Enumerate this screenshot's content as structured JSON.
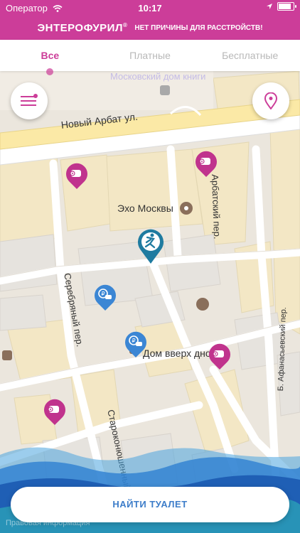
{
  "status_bar": {
    "carrier": "Оператор",
    "time": "10:17",
    "battery_level": 0.95
  },
  "banner": {
    "brand": "ЭНТЕРОФУРИЛ",
    "trademark": "®",
    "slogan": "НЕТ ПРИЧИНЫ ДЛЯ РАССТРОЙСТВ!"
  },
  "tabs": [
    {
      "label": "Все",
      "active": true
    },
    {
      "label": "Платные",
      "active": false
    },
    {
      "label": "Бесплатные",
      "active": false
    }
  ],
  "map": {
    "streets": {
      "noviy_arbat": "Новый Арбат ул.",
      "arbatskiy": "Арбатский пер.",
      "serebryaniy": "Серебряный пер.",
      "starokonyushenniy": "Староконюшенный пер.",
      "afanasyevskiy": "Б. Афанасьевский пер."
    },
    "places": {
      "dom_knigi": "Московский дом книги",
      "echo": "Эхо Москвы",
      "dom_vverh": "Дом вверх дном"
    },
    "legal": "Правовая информация",
    "icons": {
      "menu": "menu-icon",
      "location": "location-pin-icon",
      "free_marker": "toilet-paper-icon",
      "paid_marker": "ruble-icon",
      "user_marker": "person-icon"
    },
    "colors": {
      "free": "#c0338d",
      "paid": "#3b86d4",
      "user": "#1f7ba0",
      "accent": "#cc3d99"
    }
  },
  "find_button": {
    "label": "НАЙТИ ТУАЛЕТ"
  }
}
